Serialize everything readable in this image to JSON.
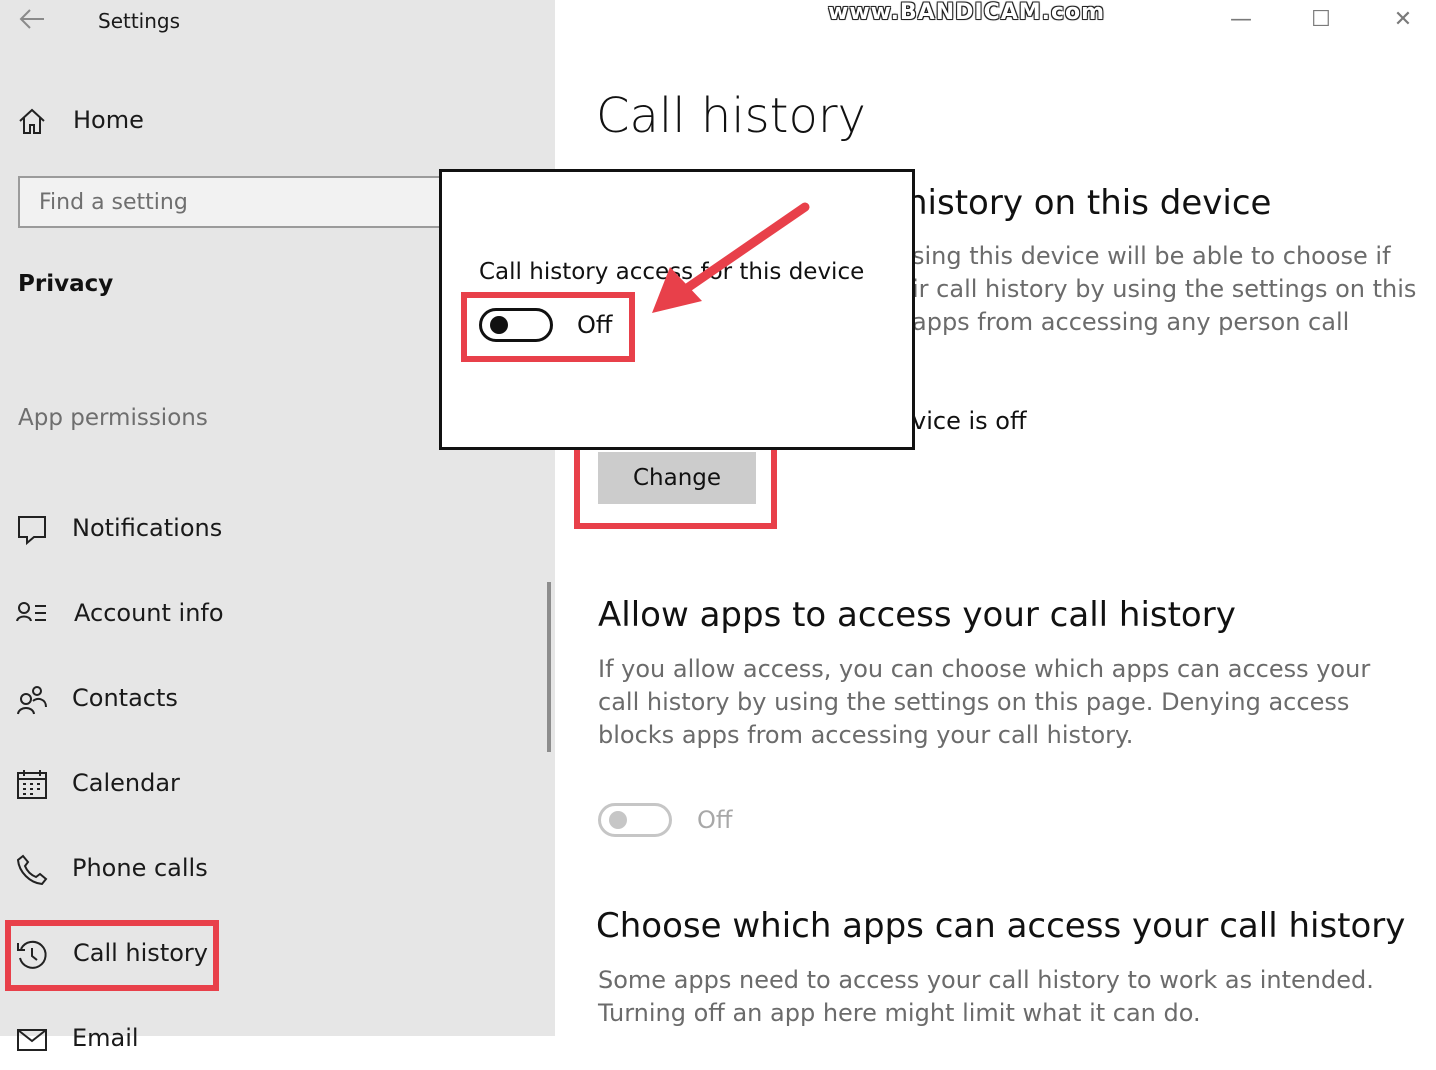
{
  "window": {
    "app_title": "Settings",
    "watermark": "www.BANDICAM.com",
    "controls": {
      "minimize": "—",
      "maximize": "☐",
      "close": "✕"
    }
  },
  "sidebar": {
    "home_label": "Home",
    "search_placeholder": "Find a setting",
    "section_heading": "Privacy",
    "permissions_heading": "App permissions",
    "items": [
      {
        "label": "Notifications",
        "icon": "notification-icon"
      },
      {
        "label": "Account info",
        "icon": "account-info-icon"
      },
      {
        "label": "Contacts",
        "icon": "contacts-icon"
      },
      {
        "label": "Calendar",
        "icon": "calendar-icon"
      },
      {
        "label": "Phone calls",
        "icon": "phone-icon"
      },
      {
        "label": "Call history",
        "icon": "history-icon",
        "selected": true
      },
      {
        "label": "Email",
        "icon": "email-icon"
      }
    ]
  },
  "main": {
    "page_title": "Call history",
    "device_section": {
      "title_visible": "history on this device",
      "desc_lines": [
        "sing this device will be able to choose if",
        "ir call history by using the settings on this",
        "apps from accessing any person call"
      ],
      "status_visible": "vice is off",
      "change_button": "Change"
    },
    "allow_section": {
      "title": "Allow apps to access your call history",
      "description": "If you allow access, you can choose which apps can access your call history by using the settings on this page. Denying access blocks apps from accessing your call history.",
      "toggle_state": "Off"
    },
    "choose_section": {
      "title": "Choose which apps can access your call history",
      "description": "Some apps need to access your call history to work as intended. Turning off an app here might limit what it can do."
    }
  },
  "popup": {
    "label": "Call history access for this device",
    "toggle_state": "Off"
  },
  "colors": {
    "sidebar_bg": "#e6e6e6",
    "annotation_red": "#e8404a",
    "button_bg": "#cccccc"
  }
}
